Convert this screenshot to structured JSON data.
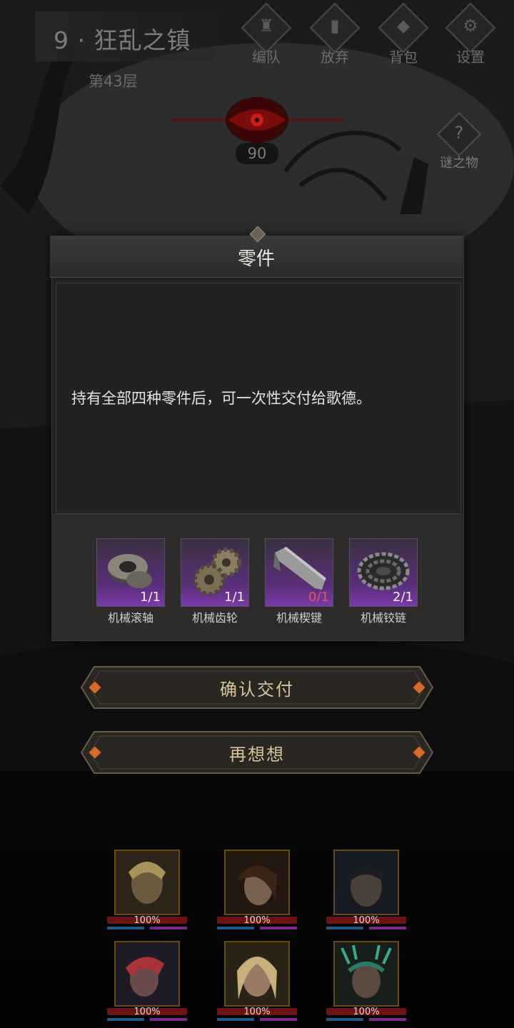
{
  "hud": {
    "stage_title": "9 · 狂乱之镇",
    "floor": "第43层",
    "buttons": [
      {
        "label": "编队",
        "icon": "helmet-icon"
      },
      {
        "label": "放弃",
        "icon": "door-exit-icon"
      },
      {
        "label": "背包",
        "icon": "bag-icon"
      },
      {
        "label": "设置",
        "icon": "gear-icon"
      }
    ],
    "counter": "90",
    "mystery_label": "谜之物"
  },
  "modal": {
    "title": "零件",
    "description": "持有全部四种零件后，可一次性交付给歌德。",
    "items": [
      {
        "name": "机械滚轴",
        "count": "1/1",
        "icon": "roller-icon",
        "owned": 1,
        "required": 1
      },
      {
        "name": "机械齿轮",
        "count": "1/1",
        "icon": "gears-icon",
        "owned": 1,
        "required": 1
      },
      {
        "name": "机械楔键",
        "count": "0/1",
        "icon": "wedge-key-icon",
        "owned": 0,
        "required": 1
      },
      {
        "name": "机械铰链",
        "count": "2/1",
        "icon": "chain-icon",
        "owned": 2,
        "required": 1
      }
    ]
  },
  "actions": {
    "confirm": "确认交付",
    "cancel": "再想想"
  },
  "team": [
    {
      "hp": "100%",
      "icon": "hero-portrait-blonde"
    },
    {
      "hp": "100%",
      "icon": "hero-portrait-brunette"
    },
    {
      "hp": "100%",
      "icon": "hero-portrait-dark"
    },
    {
      "hp": "100%",
      "icon": "hero-portrait-redhair"
    },
    {
      "hp": "100%",
      "icon": "hero-portrait-blonde-2"
    },
    {
      "hp": "100%",
      "icon": "hero-portrait-antler"
    }
  ],
  "colors": {
    "accent": "#d8c39e",
    "item_bg": "#5a2f7a",
    "missing_count": "#e05a5a",
    "hp_bar": "#6a1414"
  }
}
